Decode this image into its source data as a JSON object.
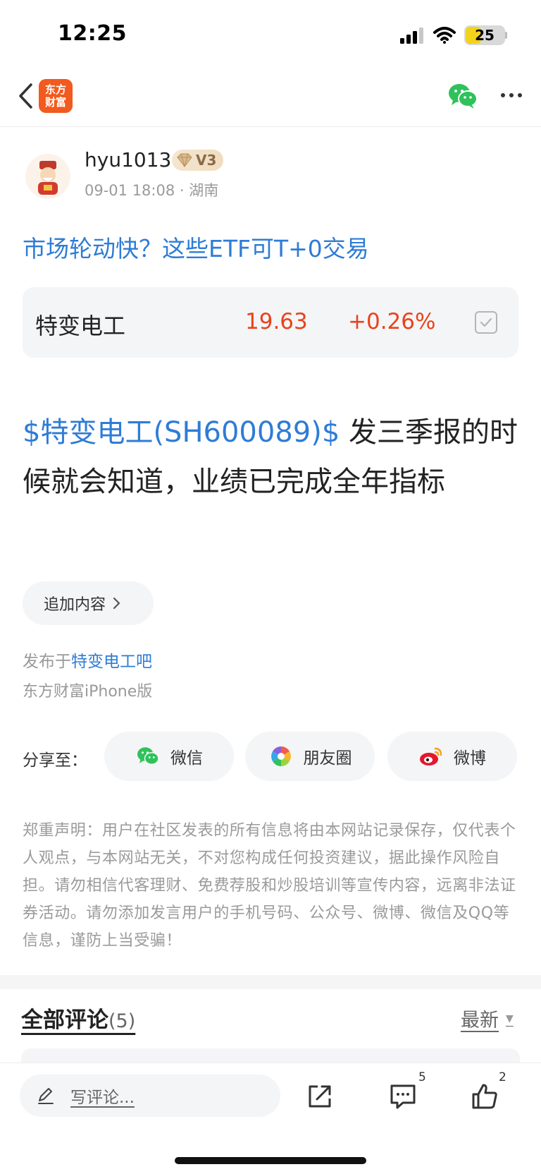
{
  "status_bar": {
    "time": "12:25",
    "battery": "25"
  },
  "nav": {
    "logo_line1": "东方",
    "logo_line2": "财富"
  },
  "author": {
    "name": "hyu1013",
    "level": "V3",
    "meta": "09-01 18:08 · 湖南"
  },
  "topic": {
    "title": "市场轮动快？这些ETF可T+0交易"
  },
  "stock": {
    "name": "特变电工",
    "price": "19.63",
    "change": "+0.26%"
  },
  "post": {
    "cashtag": "$特变电工(SH600089)$",
    "text": " 发三季报的时候就会知道，业绩已完成全年指标"
  },
  "actions": {
    "add_content": "追加内容"
  },
  "publish": {
    "prefix": "发布于",
    "forum": "特变电工吧",
    "client": "东方财富iPhone版"
  },
  "share": {
    "label": "分享至：",
    "wechat": "微信",
    "moments": "朋友圈",
    "weibo": "微博"
  },
  "disclaimer": "郑重声明：用户在社区发表的所有信息将由本网站记录保存，仅代表个人观点，与本网站无关，不对您构成任何投资建议，据此操作风险自担。请勿相信代客理财、免费荐股和炒股培训等宣传内容，远离非法证券活动。请勿添加发言用户的手机号码、公众号、微博、微信及QQ等信息，谨防上当受骗！",
  "comments": {
    "title": "全部评论",
    "count": "(5)",
    "sort": "最新"
  },
  "bottom_bar": {
    "placeholder": "写评论...",
    "comment_count": "5",
    "like_count": "2"
  },
  "colors": {
    "link": "#2e7cd6",
    "rise": "#e8431c",
    "brand": "#f25a1e",
    "wechat": "#2fc25b"
  },
  "icons": [
    "back-icon",
    "wechat-icon",
    "more-icon",
    "chevron-right-icon",
    "moments-icon",
    "weibo-icon",
    "edit-icon",
    "share-icon",
    "comment-icon",
    "like-icon",
    "checkbox-icon"
  ]
}
